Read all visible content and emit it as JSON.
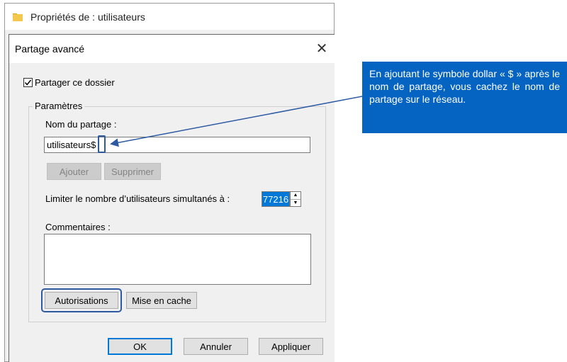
{
  "outer_window": {
    "title": "Propriétés de : utilisateurs",
    "icon": "folder-icon"
  },
  "dialog": {
    "title": "Partage avancé",
    "close_icon": "close-icon",
    "share_checkbox": {
      "label": "Partager ce dossier",
      "checked": true
    },
    "settings_group": {
      "legend": "Paramètres",
      "share_name_label": "Nom du partage :",
      "share_name_value": "utilisateurs$",
      "add_button": "Ajouter",
      "remove_button": "Supprimer",
      "limit_label": "Limiter le nombre d’utilisateurs simultanés à :",
      "limit_value": "77216",
      "comments_label": "Commentaires :",
      "comments_value": "",
      "permissions_button": "Autorisations",
      "caching_button": "Mise en cache"
    },
    "ok_button": "OK",
    "cancel_button": "Annuler",
    "apply_button": "Appliquer"
  },
  "callout": {
    "text": "En ajoutant le symbole dollar « $ » après le nom de partage, vous cachez le nom de partage sur le réseau."
  },
  "colors": {
    "callout_bg": "#0563c1",
    "highlight": "#2d5aa3",
    "selection": "#0078d7"
  }
}
